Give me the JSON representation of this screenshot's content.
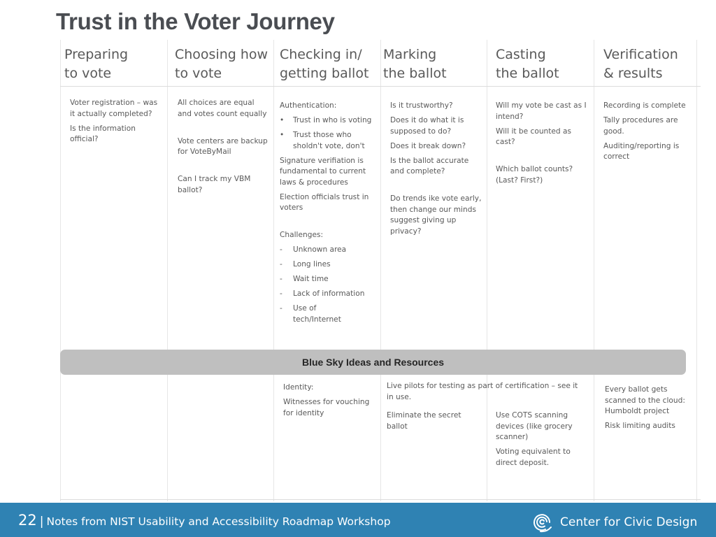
{
  "title": "Trust in the Voter Journey",
  "columns": [
    {
      "header_line1": "Preparing",
      "header_line2": "to vote",
      "items": [
        {
          "text": "Voter registration – was it actually completed?"
        },
        {
          "text": "Is the information official?"
        }
      ],
      "blue_sky": []
    },
    {
      "header_line1": "Choosing how",
      "header_line2": "to vote",
      "items": [
        {
          "text": "All choices are equal and votes count equally"
        },
        {
          "text": "Vote centers are backup for VoteByMail"
        },
        {
          "text": "Can I track my VBM ballot?"
        }
      ],
      "blue_sky": []
    },
    {
      "header_line1": "Checking in/",
      "header_line2": "getting ballot",
      "items": [
        {
          "text": "Authentication:"
        },
        {
          "bullet": "•",
          "text": "Trust in who is voting"
        },
        {
          "bullet": "•",
          "text": "Trust those who sholdn't vote, don't"
        },
        {
          "text": "Signature verifiation is fundamental to current laws & procedures"
        },
        {
          "text": "Election officials trust in voters"
        },
        {
          "text": "Challenges:"
        },
        {
          "bullet": "-",
          "text": "Unknown area"
        },
        {
          "bullet": "-",
          "text": "Long lines"
        },
        {
          "bullet": "-",
          "text": "Wait time"
        },
        {
          "bullet": "-",
          "text": "Lack of information"
        },
        {
          "bullet": "-",
          "text": "Use of tech/Internet"
        }
      ],
      "blue_sky": [
        {
          "text": "Identity:"
        },
        {
          "text": "Witnesses for vouching for identity"
        }
      ]
    },
    {
      "header_line1": "Marking",
      "header_line2": "the ballot",
      "items": [
        {
          "text": "Is it trustworthy?"
        },
        {
          "text": "Does it do what it is supposed to do?"
        },
        {
          "text": "Does it break down?"
        },
        {
          "text": "Is the ballot accurate and complete?"
        },
        {
          "text": "Do trends ike vote early, then change our minds suggest giving up privacy?"
        }
      ],
      "blue_sky": [
        {
          "text": "Live pilots for testing as part of certification – see it in use."
        },
        {
          "text": "Eliminate the secret ballot"
        }
      ]
    },
    {
      "header_line1": "Casting",
      "header_line2": "the ballot",
      "items": [
        {
          "text": "Will my vote be cast as I intend?"
        },
        {
          "text": "Will it be counted as cast?"
        },
        {
          "text": "Which ballot counts? (Last? First?)"
        }
      ],
      "blue_sky": [
        {
          "text": "Use COTS scanning devices (like grocery scanner)"
        },
        {
          "text": "Voting equivalent to direct deposit."
        }
      ]
    },
    {
      "header_line1": "Verification",
      "header_line2": "& results",
      "items": [
        {
          "text": "Recording is complete"
        },
        {
          "text": "Tally procedures are good."
        },
        {
          "text": "Auditing/reporting is correct"
        }
      ],
      "blue_sky": [
        {
          "text": "Every ballot gets scanned to the cloud: Humboldt project"
        },
        {
          "text": "Risk limiting audits"
        }
      ]
    }
  ],
  "banner": {
    "label": "Blue Sky Ideas  and Resources",
    "color": "#bfbfbf"
  },
  "footer": {
    "page_number": "22",
    "separator": "|",
    "text": "Notes from NIST Usability and Accessibility Roadmap  Workshop",
    "brand": "Center for Civic Design",
    "logo_icon": "civic-design-logo-icon",
    "color": "#2f82b3"
  }
}
